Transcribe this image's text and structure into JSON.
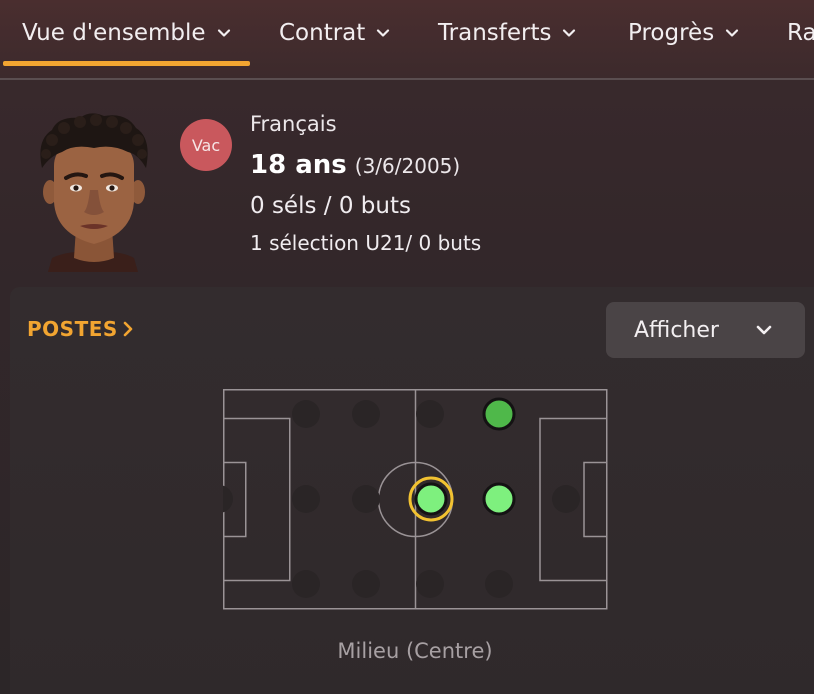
{
  "tabs": [
    {
      "label": "Vue d'ensemble",
      "active": true
    },
    {
      "label": "Contrat",
      "active": false
    },
    {
      "label": "Transferts",
      "active": false
    },
    {
      "label": "Progrès",
      "active": false
    },
    {
      "label": "Ra",
      "active": false
    }
  ],
  "player": {
    "nation_badge": "Vac",
    "nationality": "Français",
    "age": "18 ans",
    "dob": "(3/6/2005)",
    "caps": "0 séls / 0 buts",
    "u21_caps": "1 sélection U21/ 0 buts"
  },
  "positions": {
    "title": "POSTES",
    "display_button": "Afficher",
    "selected_position": "Milieu (Centre)",
    "colors": {
      "accent": "#f2a531",
      "natural": "#7ef07e",
      "accomplished": "#4fb84a",
      "empty": "#2a2526"
    }
  },
  "icons": {
    "tab_chevron": "chevron-down-icon",
    "title_arrow": "chevron-right-icon",
    "select_chevron": "chevron-down-icon"
  }
}
